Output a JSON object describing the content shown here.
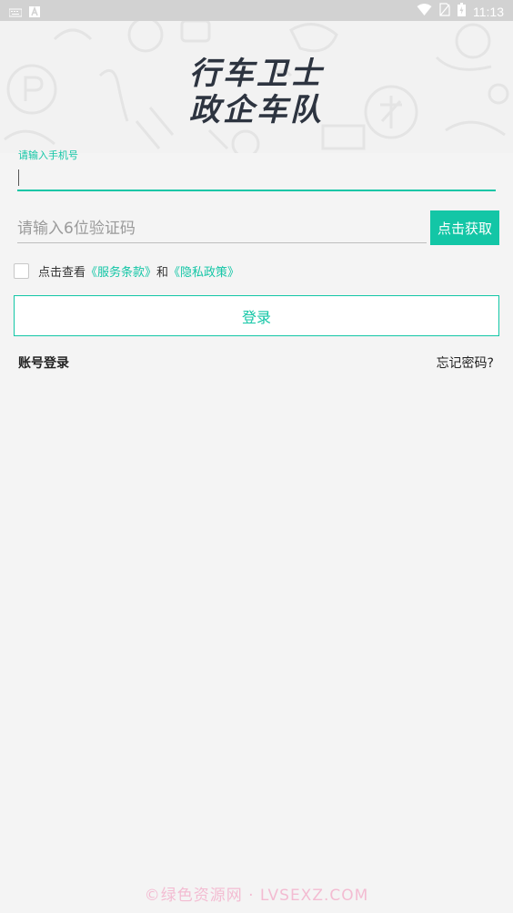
{
  "status_bar": {
    "time": "11:13",
    "left_icons": [
      "keyboard-icon",
      "app-notification-icon"
    ],
    "right_icons": [
      "wifi-icon",
      "no-sim-icon",
      "battery-icon"
    ]
  },
  "brand": {
    "line1": "行车卫士",
    "line2": "政企车队",
    "color": "#2d3440"
  },
  "form": {
    "phone_label": "请输入手机号",
    "phone_value": "",
    "code_placeholder": "请输入6位验证码",
    "get_code_label": "点击获取",
    "agree_prefix": "点击查看",
    "terms_link": "《服务条款》",
    "and_text": "和",
    "privacy_link": "《隐私政策》",
    "checked": false,
    "login_label": "登录"
  },
  "footer_links": {
    "account_login": "账号登录",
    "forgot_password": "忘记密码?"
  },
  "watermark": "©绿色资源网 · LVSEXZ.COM",
  "colors": {
    "accent": "#13c6a6",
    "background": "#f4f4f4",
    "status_bar": "#d2d2d2"
  }
}
